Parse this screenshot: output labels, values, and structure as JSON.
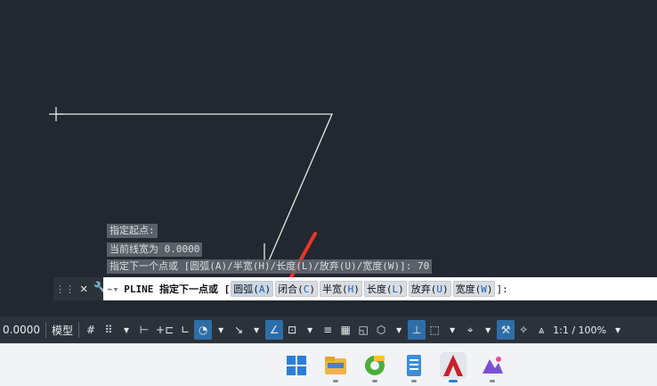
{
  "history": [
    "指定起点:",
    "当前线宽为 0.0000",
    "指定下一个点或 [圆弧(A)/半宽(H)/长度(L)/放弃(U)/宽度(W)]: 70"
  ],
  "command": {
    "prefix": "PLINE 指定下一点或 [",
    "options": [
      {
        "label": "圆弧(",
        "key": "A",
        "tail": ")"
      },
      {
        "label": "闭合(",
        "key": "C",
        "tail": ")"
      },
      {
        "label": "半宽(",
        "key": "H",
        "tail": ")"
      },
      {
        "label": "长度(",
        "key": "L",
        "tail": ")"
      },
      {
        "label": "放弃(",
        "key": "U",
        "tail": ")"
      },
      {
        "label": "宽度(",
        "key": "W",
        "tail": ")"
      }
    ],
    "suffix": "]:"
  },
  "status": {
    "coord": "0.0000",
    "model": "模型",
    "scale": "1:1 / 100%"
  },
  "colors": {
    "canvas": "#212830",
    "line": "#e6e6e6",
    "arrow": "#e8352a",
    "active": "#2e6ea8"
  }
}
